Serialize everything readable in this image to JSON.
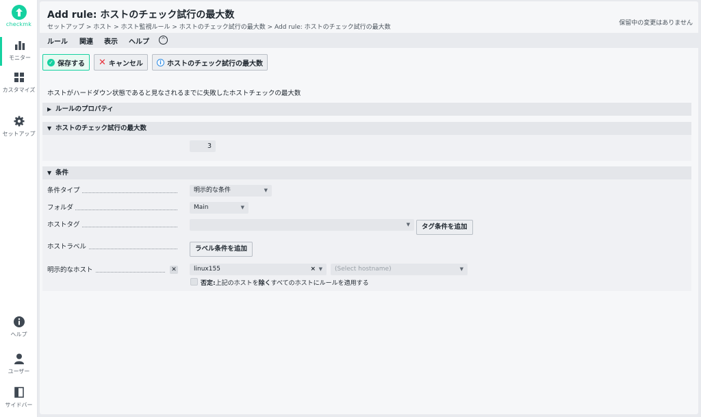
{
  "sidebar": {
    "logo_text": "checkmk",
    "items": [
      {
        "label": "モニター",
        "icon": "bar-chart-icon"
      },
      {
        "label": "カスタマイズ",
        "icon": "grid-icon"
      },
      {
        "label": "セットアップ",
        "icon": "gear-icon"
      },
      {
        "label": "ヘルプ",
        "icon": "info-icon"
      },
      {
        "label": "ユーザー",
        "icon": "user-icon"
      },
      {
        "label": "サイドバー",
        "icon": "sidebar-toggle-icon"
      }
    ]
  },
  "header": {
    "title": "Add rule: ホストのチェック試行の最大数",
    "breadcrumb": "セットアップ > ホスト > ホスト監視ルール > ホストのチェック試行の最大数 > Add rule: ホストのチェック試行の最大数",
    "pending": "保留中の変更はありません"
  },
  "menu": {
    "items": [
      "ルール",
      "関連",
      "表示",
      "ヘルプ"
    ]
  },
  "toolbar": {
    "save_label": "保存する",
    "cancel_label": "キャンセル",
    "ruleset_label": "ホストのチェック試行の最大数"
  },
  "description": "ホストがハードダウン状態であると見なされるまでに失敗したホストチェックの最大数",
  "sections": {
    "properties": "ルールのプロパティ",
    "value": "ホストのチェック試行の最大数",
    "conditions": "条件"
  },
  "value": {
    "max_attempts": "3"
  },
  "conditions": {
    "type_label": "条件タイプ",
    "type_value": "明示的な条件",
    "folder_label": "フォルダ",
    "folder_value": "Main",
    "host_tag_label": "ホストタグ",
    "host_tag_value": "",
    "add_tag_button": "タグ条件を追加",
    "host_label_label": "ホストラベル",
    "add_label_button": "ラベル条件を追加",
    "explicit_hosts_label": "明示的なホスト",
    "explicit_host_value": "linux155",
    "hostname_placeholder": "(Select hostname)",
    "negate_prefix": "否定:",
    "negate_text_1": "上記のホストを",
    "negate_bold": "除く",
    "negate_text_2": "すべてのホストにルールを適用する"
  },
  "colors": {
    "brand": "#15d1a0",
    "cancel_x": "#e8303a",
    "info_blue": "#2d8ce6"
  }
}
